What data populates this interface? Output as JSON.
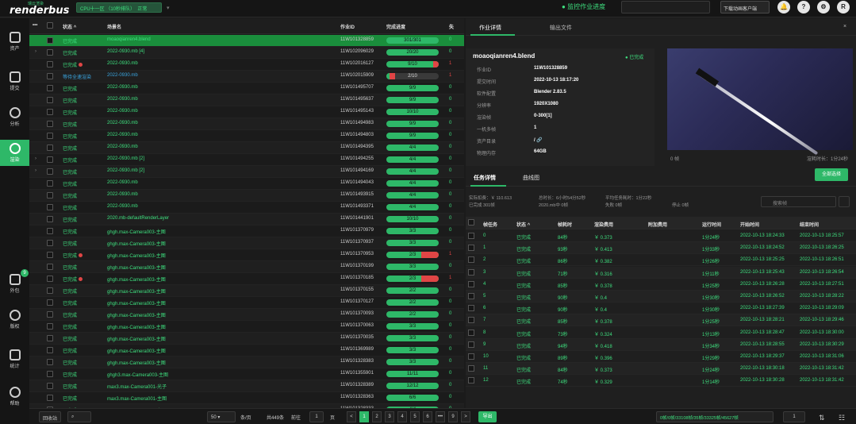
{
  "topbar": {
    "logo_cn": "瑞云渲染",
    "logo_en": "renderbus",
    "cpu_label": "CPU十一区 （10秒排队）",
    "cpu_status": "正常",
    "monitor_label": "监控作业进度",
    "search_placeholder": "",
    "download_label": "下载动画客户端",
    "bell_icon": "bell-icon",
    "help_label": "?",
    "settings_icon": "gear-icon",
    "user_initial": "R"
  },
  "sidebar": {
    "items": [
      {
        "label": "资产",
        "icon": "asset-icon"
      },
      {
        "label": "提交",
        "icon": "upload-icon"
      },
      {
        "label": "分析",
        "icon": "analysis-icon"
      },
      {
        "label": "渲染",
        "icon": "render-icon"
      },
      {
        "label": "外包",
        "icon": "layers-icon",
        "badge": "9"
      },
      {
        "label": "版权",
        "icon": "copyright-icon"
      },
      {
        "label": "统计",
        "icon": "chart-icon"
      },
      {
        "label": "帮助",
        "icon": "headset-icon"
      }
    ]
  },
  "table": {
    "headers": {
      "dots": "•••",
      "status": "状态",
      "name": "场景名",
      "job_id": "作业ID",
      "progress": "完成进度",
      "fail": "失"
    },
    "rows": [
      {
        "status": "已完成",
        "name": "moaoqianren4.blend",
        "job_id": "11W101328859",
        "progress": "301/301",
        "fail": "0",
        "failed": false,
        "wait": false,
        "dot": false,
        "expand": false
      },
      {
        "status": "已完成",
        "name": "2022-0930.mb [4]",
        "job_id": "11W102096029",
        "progress": "20/20",
        "fail": "0",
        "failed": false,
        "wait": false,
        "dot": false,
        "expand": true
      },
      {
        "status": "已完成",
        "name": "2022-0930.mb",
        "job_id": "11W102016127",
        "progress": "9/10",
        "fail": "1",
        "failed": true,
        "wait": false,
        "dot": true,
        "expand": false
      },
      {
        "status": "等待全速渲染",
        "name": "2022-0930.mb",
        "job_id": "11W102015909",
        "progress": "2/10",
        "fail": "1",
        "failed": true,
        "wait": true,
        "dot": false,
        "expand": false
      },
      {
        "status": "已完成",
        "name": "2022-0930.mb",
        "job_id": "11W101495707",
        "progress": "9/9",
        "fail": "0",
        "failed": false,
        "wait": false,
        "dot": false,
        "expand": false
      },
      {
        "status": "已完成",
        "name": "2022-0930.mb",
        "job_id": "11W101495637",
        "progress": "9/9",
        "fail": "0",
        "failed": false,
        "wait": false,
        "dot": false,
        "expand": false
      },
      {
        "status": "已完成",
        "name": "2022-0930.mb",
        "job_id": "11W101495143",
        "progress": "10/10",
        "fail": "0",
        "failed": false,
        "wait": false,
        "dot": false,
        "expand": false
      },
      {
        "status": "已完成",
        "name": "2022-0930.mb",
        "job_id": "11W101494983",
        "progress": "9/9",
        "fail": "0",
        "failed": false,
        "wait": false,
        "dot": false,
        "expand": false
      },
      {
        "status": "已完成",
        "name": "2022-0930.mb",
        "job_id": "11W101494803",
        "progress": "9/9",
        "fail": "0",
        "failed": false,
        "wait": false,
        "dot": false,
        "expand": false
      },
      {
        "status": "已完成",
        "name": "2022-0930.mb",
        "job_id": "11W101494395",
        "progress": "4/4",
        "fail": "0",
        "failed": false,
        "wait": false,
        "dot": false,
        "expand": false
      },
      {
        "status": "已完成",
        "name": "2022-0930.mb [2]",
        "job_id": "11W101494255",
        "progress": "4/4",
        "fail": "0",
        "failed": false,
        "wait": false,
        "dot": false,
        "expand": true
      },
      {
        "status": "已完成",
        "name": "2022-0930.mb [2]",
        "job_id": "11W101494169",
        "progress": "4/4",
        "fail": "0",
        "failed": false,
        "wait": false,
        "dot": false,
        "expand": true
      },
      {
        "status": "已完成",
        "name": "2022-0930.mb",
        "job_id": "11W101494043",
        "progress": "4/4",
        "fail": "0",
        "failed": false,
        "wait": false,
        "dot": false,
        "expand": false
      },
      {
        "status": "已完成",
        "name": "2022-0930.mb",
        "job_id": "11W101493915",
        "progress": "4/4",
        "fail": "0",
        "failed": false,
        "wait": false,
        "dot": false,
        "expand": false
      },
      {
        "status": "已完成",
        "name": "2022-0930.mb",
        "job_id": "11W101493371",
        "progress": "4/4",
        "fail": "0",
        "failed": false,
        "wait": false,
        "dot": false,
        "expand": false
      },
      {
        "status": "已完成",
        "name": "2020.mb-defaultRenderLayer",
        "job_id": "11W101441901",
        "progress": "10/10",
        "fail": "0",
        "failed": false,
        "wait": false,
        "dot": false,
        "expand": false
      },
      {
        "status": "已完成",
        "name": "ghgh.max-Camera003-主图",
        "job_id": "11W101370979",
        "progress": "3/3",
        "fail": "0",
        "failed": false,
        "wait": false,
        "dot": false,
        "expand": false
      },
      {
        "status": "已完成",
        "name": "ghgh.max-Camera003-主图",
        "job_id": "11W101370937",
        "progress": "3/3",
        "fail": "0",
        "failed": false,
        "wait": false,
        "dot": false,
        "expand": false
      },
      {
        "status": "已完成",
        "name": "ghgh.max-Camera003-主图",
        "job_id": "11W101370953",
        "progress": "2/3",
        "fail": "1",
        "failed": true,
        "wait": false,
        "dot": true,
        "expand": false
      },
      {
        "status": "已完成",
        "name": "ghgh.max-Camera003-主图",
        "job_id": "11W101370199",
        "progress": "3/3",
        "fail": "0",
        "failed": false,
        "wait": false,
        "dot": false,
        "expand": false
      },
      {
        "status": "已完成",
        "name": "ghgh.max-Camera003-主图",
        "job_id": "11W101370185",
        "progress": "2/3",
        "fail": "1",
        "failed": true,
        "wait": false,
        "dot": true,
        "expand": false
      },
      {
        "status": "已完成",
        "name": "ghgh.max-Camera003-主图",
        "job_id": "11W101370155",
        "progress": "2/2",
        "fail": "0",
        "failed": false,
        "wait": false,
        "dot": false,
        "expand": false
      },
      {
        "status": "已完成",
        "name": "ghgh.max-Camera003-主图",
        "job_id": "11W101370127",
        "progress": "2/2",
        "fail": "0",
        "failed": false,
        "wait": false,
        "dot": false,
        "expand": false
      },
      {
        "status": "已完成",
        "name": "ghgh.max-Camera003-主图",
        "job_id": "11W101370093",
        "progress": "2/2",
        "fail": "0",
        "failed": false,
        "wait": false,
        "dot": false,
        "expand": false
      },
      {
        "status": "已完成",
        "name": "ghgh.max-Camera003-主图",
        "job_id": "11W101370063",
        "progress": "3/3",
        "fail": "0",
        "failed": false,
        "wait": false,
        "dot": false,
        "expand": false
      },
      {
        "status": "已完成",
        "name": "ghgh.max-Camera003-主图",
        "job_id": "11W101370035",
        "progress": "3/3",
        "fail": "0",
        "failed": false,
        "wait": false,
        "dot": false,
        "expand": false
      },
      {
        "status": "已完成",
        "name": "ghgh.max-Camera003-主图",
        "job_id": "11W101369989",
        "progress": "3/3",
        "fail": "0",
        "failed": false,
        "wait": false,
        "dot": false,
        "expand": false
      },
      {
        "status": "已完成",
        "name": "ghgh.max-Camera003-主图",
        "job_id": "11W101328383",
        "progress": "3/3",
        "fail": "0",
        "failed": false,
        "wait": false,
        "dot": false,
        "expand": false
      },
      {
        "status": "已完成",
        "name": "ghgh3.max-Camera003-主图",
        "job_id": "11W101355901",
        "progress": "11/11",
        "fail": "0",
        "failed": false,
        "wait": false,
        "dot": false,
        "expand": false
      },
      {
        "status": "已完成",
        "name": "max3.max-Camera001-光子",
        "job_id": "11W101328389",
        "progress": "12/12",
        "fail": "0",
        "failed": false,
        "wait": false,
        "dot": false,
        "expand": false
      },
      {
        "status": "已完成",
        "name": "max3.max-Camera001-主图",
        "job_id": "11W101328363",
        "progress": "6/6",
        "fail": "0",
        "failed": false,
        "wait": false,
        "dot": false,
        "expand": false
      },
      {
        "status": "已完成",
        "name": "max3.max-Camera001-主图",
        "job_id": "11W101328333",
        "progress": "4/4",
        "fail": "0",
        "failed": false,
        "wait": false,
        "dot": false,
        "expand": false
      }
    ]
  },
  "footer": {
    "recycle_label": "回收站",
    "page_size": "50",
    "per_page_label": "条/页",
    "total_label": "共449条",
    "goto_label": "前往",
    "goto_value": "1",
    "page_label": "页",
    "pages": [
      "1",
      "2",
      "3",
      "4",
      "5",
      "6",
      "•••",
      "9"
    ],
    "prev": "<",
    "next": ">",
    "export_label": "导出",
    "summary": "0帧/0帧/33108帧/35帧/33325帧/45627帧",
    "right_value": "1"
  },
  "detail": {
    "tab_job": "作业详情",
    "tab_output": "输出文件",
    "close": "×",
    "title": "moaoqianren4.blend",
    "status": "● 已完成",
    "fields": [
      {
        "k": "作业ID",
        "v": "11W101328859"
      },
      {
        "k": "提交时间",
        "v": "2022-10-13 18:17:20"
      },
      {
        "k": "软件配置",
        "v": "Blender 2.83.5"
      },
      {
        "k": "分辨率",
        "v": "1920X1080"
      },
      {
        "k": "渲染帧",
        "v": "0-300[1]"
      },
      {
        "k": "一机多帧",
        "v": "1"
      },
      {
        "k": "资产目录",
        "v": "/ 🔗"
      },
      {
        "k": "物理内存",
        "v": "64GB"
      }
    ],
    "preview_frame": "0 帧",
    "preview_time": "渲耗时长：1分24秒",
    "subtab_task": "任务详情",
    "subtab_curve": "曲线图",
    "select_btn": "全部选择",
    "stats": {
      "cost": "实际扣费：￥ 110.613",
      "duration": "总时长：6小时54分52秒",
      "avg": "平均任务耗时：1分22秒",
      "done": "已完成 301帧",
      "waiting": "2020.mb中 0帧",
      "failed": "失败 0帧",
      "stopped": "停止 0帧"
    },
    "search_placeholder": "搜索帧",
    "task_headers": {
      "frame": "帧任务",
      "status": "状态",
      "time": "帧耗时",
      "cost": "渲染费用",
      "extra": "附加费用",
      "run": "运行时间",
      "start": "开始时间",
      "end": "结束时间"
    },
    "tasks": [
      {
        "frame": "0",
        "status": "已完成",
        "time": "84秒",
        "cost": "￥ 0.373",
        "run": "1分24秒",
        "start": "2022-10-13 18:24:33",
        "end": "2022-10-13 18:25:57"
      },
      {
        "frame": "1",
        "status": "已完成",
        "time": "93秒",
        "cost": "￥ 0.413",
        "run": "1分33秒",
        "start": "2022-10-13 18:24:52",
        "end": "2022-10-13 18:26:25"
      },
      {
        "frame": "2",
        "status": "已完成",
        "time": "86秒",
        "cost": "￥ 0.382",
        "run": "1分26秒",
        "start": "2022-10-13 18:25:25",
        "end": "2022-10-13 18:26:51"
      },
      {
        "frame": "3",
        "status": "已完成",
        "time": "71秒",
        "cost": "￥ 0.316",
        "run": "1分11秒",
        "start": "2022-10-13 18:25:43",
        "end": "2022-10-13 18:26:54"
      },
      {
        "frame": "4",
        "status": "已完成",
        "time": "85秒",
        "cost": "￥ 0.378",
        "run": "1分25秒",
        "start": "2022-10-13 18:26:28",
        "end": "2022-10-13 18:27:51"
      },
      {
        "frame": "5",
        "status": "已完成",
        "time": "90秒",
        "cost": "￥ 0.4",
        "run": "1分30秒",
        "start": "2022-10-13 18:26:52",
        "end": "2022-10-13 18:28:22"
      },
      {
        "frame": "6",
        "status": "已完成",
        "time": "90秒",
        "cost": "￥ 0.4",
        "run": "1分30秒",
        "start": "2022-10-13 18:27:39",
        "end": "2022-10-13 18:29:09"
      },
      {
        "frame": "7",
        "status": "已完成",
        "time": "85秒",
        "cost": "￥ 0.378",
        "run": "1分25秒",
        "start": "2022-10-13 18:28:21",
        "end": "2022-10-13 18:29:46"
      },
      {
        "frame": "8",
        "status": "已完成",
        "time": "73秒",
        "cost": "￥ 0.324",
        "run": "1分13秒",
        "start": "2022-10-13 18:28:47",
        "end": "2022-10-13 18:30:00"
      },
      {
        "frame": "9",
        "status": "已完成",
        "time": "94秒",
        "cost": "￥ 0.418",
        "run": "1分34秒",
        "start": "2022-10-13 18:28:55",
        "end": "2022-10-13 18:30:29"
      },
      {
        "frame": "10",
        "status": "已完成",
        "time": "89秒",
        "cost": "￥ 0.396",
        "run": "1分29秒",
        "start": "2022-10-13 18:29:37",
        "end": "2022-10-13 18:31:06"
      },
      {
        "frame": "11",
        "status": "已完成",
        "time": "84秒",
        "cost": "￥ 0.373",
        "run": "1分24秒",
        "start": "2022-10-13 18:30:18",
        "end": "2022-10-13 18:31:42"
      },
      {
        "frame": "12",
        "status": "已完成",
        "time": "74秒",
        "cost": "￥ 0.329",
        "run": "1分14秒",
        "start": "2022-10-13 18:30:28",
        "end": "2022-10-13 18:31:42"
      }
    ]
  }
}
